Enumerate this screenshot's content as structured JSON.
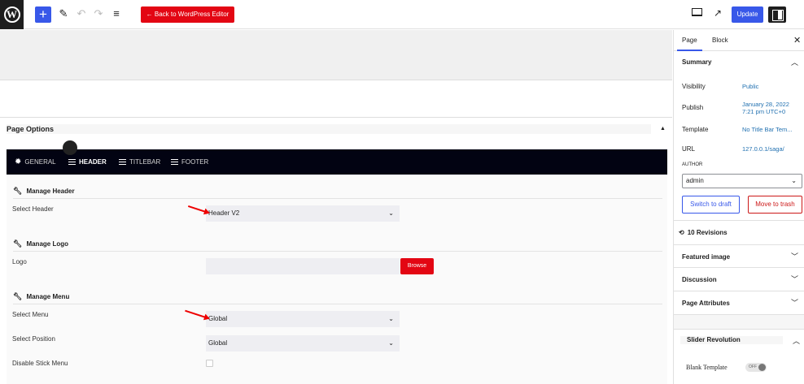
{
  "toolbar": {
    "logo": "W",
    "add_icon": "+",
    "back_label": "← Back to WordPress Editor",
    "update_label": "Update"
  },
  "page_options": {
    "title": "Page Options",
    "tabs": [
      "GENERAL",
      "HEADER",
      "TITLEBAR",
      "FOOTER"
    ],
    "active_tab": "HEADER",
    "sections": {
      "manage_header": "Manage Header",
      "manage_logo": "Manage Logo",
      "manage_menu": "Manage Menu"
    },
    "fields": {
      "select_header_label": "Select Header",
      "select_header_value": "Header V2",
      "logo_label": "Logo",
      "browse_label": "Browse",
      "select_menu_label": "Select Menu",
      "select_menu_value": "Global",
      "select_position_label": "Select Position",
      "select_position_value": "Global",
      "disable_stick_label": "Disable Stick Menu"
    }
  },
  "sidebar": {
    "tabs": [
      "Page",
      "Block"
    ],
    "summary_title": "Summary",
    "visibility_label": "Visibility",
    "visibility_value": "Public",
    "publish_label": "Publish",
    "publish_value_1": "January 28, 2022",
    "publish_value_2": "7:21 pm UTC+0",
    "template_label": "Template",
    "template_value": "No Title Bar Tem...",
    "url_label": "URL",
    "url_value": "127.0.0.1/saga/",
    "author_label": "AUTHOR",
    "author_value": "admin",
    "switch_draft": "Switch to draft",
    "move_trash": "Move to trash",
    "revisions": "10 Revisions",
    "featured_image": "Featured image",
    "discussion": "Discussion",
    "page_attributes": "Page Attributes",
    "slider_revolution": "Slider Revolution",
    "blank_template": "Blank Template",
    "toggle_state": "OFF"
  },
  "icons": [
    "wordpress-logo-icon",
    "pencil-icon",
    "undo-icon",
    "redo-icon",
    "list-view-icon",
    "preview-icon",
    "external-link-icon",
    "settings-icon",
    "gear-icon",
    "wrench-icon",
    "history-icon",
    "chevron-down-icon",
    "chevron-up-icon",
    "close-icon"
  ],
  "colors": {
    "wp_blue": "#3858e9",
    "red_accent": "#e30613",
    "tab_bar_bg": "#020312",
    "link_blue": "#2271b1"
  }
}
